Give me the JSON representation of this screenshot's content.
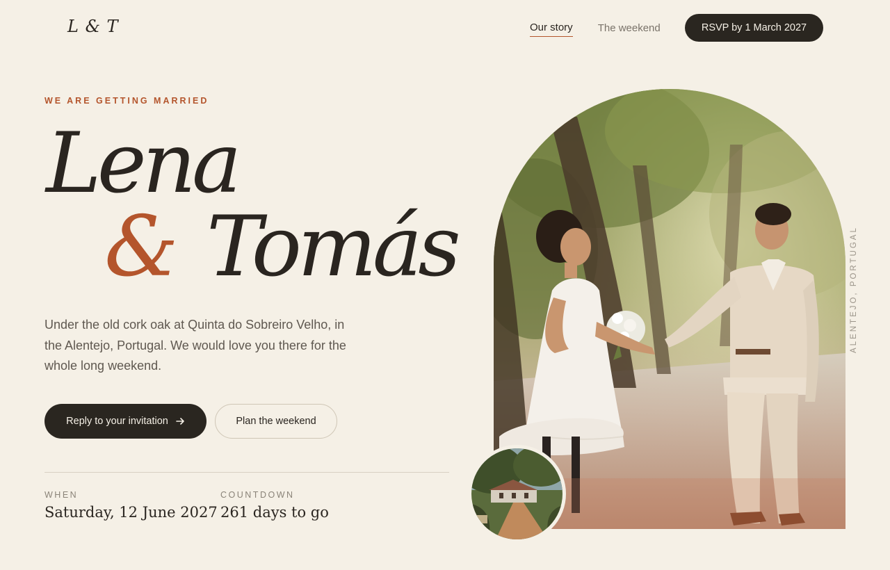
{
  "header": {
    "logo": "L & T",
    "nav": [
      {
        "label": "Our story",
        "active": true
      },
      {
        "label": "The weekend",
        "active": false
      }
    ],
    "rsvp_button": "RSVP by 1 March 2027"
  },
  "hero": {
    "eyebrow": "WE ARE GETTING MARRIED",
    "name_1": "Lena",
    "ampersand": "&",
    "name_2": "Tomás",
    "intro": "Under the old cork oak at Quinta do Sobreiro Velho, in the Alentejo, Portugal. We would love you there for the whole long weekend.",
    "primary_button": "Reply to your invitation",
    "primary_button_icon": "arrow-right-icon",
    "secondary_button": "Plan the weekend"
  },
  "details": {
    "when_label": "WHEN",
    "when_value": "Saturday, 12 June 2027",
    "countdown_label": "COUNTDOWN",
    "countdown_value": "261 days to go"
  },
  "photo": {
    "location": "ALENTEJO, PORTUGAL"
  },
  "colors": {
    "background": "#f5f0e6",
    "accent": "#b4552c",
    "dark": "#2a2620"
  }
}
